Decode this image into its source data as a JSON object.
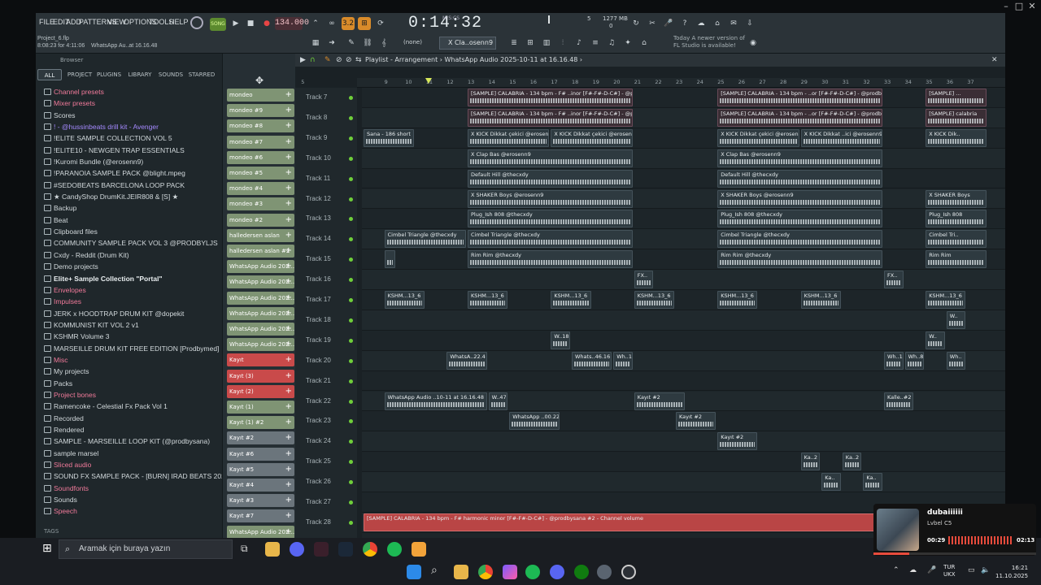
{
  "window": {
    "min": "–",
    "max": "□",
    "close": "✕"
  },
  "menu": [
    "FILE",
    "EDIT",
    "ADD",
    "PATTERNS",
    "VIEW",
    "OPTIONS",
    "TOOLS",
    "HELP"
  ],
  "toolbar": {
    "tempo": "134.000",
    "time": "0:14:32",
    "time_unit": "M:S:CS",
    "pattern_select": "X Cla..osenn9",
    "none_label": "(none)",
    "cpu": "5",
    "mem": "1277 MB",
    "mem_sub": "0"
  },
  "project": {
    "name": "Project_6.flp",
    "pos": "8:08:23 for 4:11:06",
    "last": "WhatsApp Au..at 16.16.48"
  },
  "hint": {
    "line1": "Today  A newer version of",
    "line2": "FL Studio is available!"
  },
  "browser": {
    "title": "Browser",
    "tabs": [
      "ALL",
      "PROJECT",
      "PLUGINS",
      "LIBRARY",
      "SOUNDS",
      "STARRED"
    ],
    "items": [
      {
        "label": "Channel presets",
        "style": "pink"
      },
      {
        "label": "Mixer presets",
        "style": "pink"
      },
      {
        "label": "Scores",
        "style": "normal"
      },
      {
        "label": "! - @hussinbeats drill kit - Avenger",
        "style": "purple"
      },
      {
        "label": "!ELITE SAMPLE COLLECTION VOL 5",
        "style": "normal"
      },
      {
        "label": "!ELITE10 - NEWGEN TRAP ESSENTIALS",
        "style": "normal"
      },
      {
        "label": "!Kuromi Bundle (@erosenn9)",
        "style": "normal"
      },
      {
        "label": "!PARANOIA SAMPLE PACK @blight.mpeg",
        "style": "normal"
      },
      {
        "label": "#SEDOBEATS BARCELONA LOOP PACK",
        "style": "normal"
      },
      {
        "label": "★ CandyShop DrumKit.JEIR808 & [S] ★",
        "style": "normal"
      },
      {
        "label": "Backup",
        "style": "normal"
      },
      {
        "label": "Beat",
        "style": "normal"
      },
      {
        "label": "Clipboard files",
        "style": "normal"
      },
      {
        "label": "COMMUNITY SAMPLE PACK VOL 3 @PRODBYLJS",
        "style": "normal"
      },
      {
        "label": "Cxdy - Reddit (Drum Kit)",
        "style": "normal"
      },
      {
        "label": "Demo projects",
        "style": "normal"
      },
      {
        "label": "Elite+ Sample Collection \"Portal\"",
        "style": "bold"
      },
      {
        "label": "Envelopes",
        "style": "pink"
      },
      {
        "label": "Impulses",
        "style": "pink"
      },
      {
        "label": "JERK x HOODTRAP DRUM KIT @dopekit",
        "style": "normal"
      },
      {
        "label": "KOMMUNIST KIT VOL 2 v1",
        "style": "normal"
      },
      {
        "label": "KSHMR Volume 3",
        "style": "normal"
      },
      {
        "label": "MARSEILLE DRUM KIT FREE EDITION [Prodbymed]",
        "style": "normal"
      },
      {
        "label": "Misc",
        "style": "pink"
      },
      {
        "label": "My projects",
        "style": "normal"
      },
      {
        "label": "Packs",
        "style": "normal"
      },
      {
        "label": "Project bones",
        "style": "pink"
      },
      {
        "label": "Ramencoke - Celestial Fx Pack Vol 1",
        "style": "normal"
      },
      {
        "label": "Recorded",
        "style": "normal"
      },
      {
        "label": "Rendered",
        "style": "normal"
      },
      {
        "label": "SAMPLE - MARSEILLE LOOP KIT (@prodbysana)",
        "style": "normal"
      },
      {
        "label": "sample marsel",
        "style": "normal"
      },
      {
        "label": "Sliced audio",
        "style": "pink"
      },
      {
        "label": "SOUND FX SAMPLE PACK - [BURN] IRAD BEATS 2024",
        "style": "normal"
      },
      {
        "label": "Soundfonts",
        "style": "pink"
      },
      {
        "label": "Sounds",
        "style": "normal"
      },
      {
        "label": "Speech",
        "style": "pink"
      }
    ],
    "tags": "TAGS"
  },
  "channels": [
    {
      "label": "mondeo",
      "style": "green"
    },
    {
      "label": "mondeo #9",
      "style": "green"
    },
    {
      "label": "mondeo #8",
      "style": "green"
    },
    {
      "label": "mondeo #7",
      "style": "green"
    },
    {
      "label": "mondeo #6",
      "style": "green"
    },
    {
      "label": "mondeo #5",
      "style": "green"
    },
    {
      "label": "mondeo #4",
      "style": "green"
    },
    {
      "label": "mondeo #3",
      "style": "green"
    },
    {
      "label": "mondeo #2",
      "style": "green"
    },
    {
      "label": "halledersen aslan",
      "style": "green"
    },
    {
      "label": "halledersen aslan #2",
      "style": "green"
    },
    {
      "label": "WhatsApp Audio 202...",
      "style": "green"
    },
    {
      "label": "WhatsApp Audio 202...",
      "style": "green"
    },
    {
      "label": "WhatsApp Audio 202...",
      "style": "green"
    },
    {
      "label": "WhatsApp Audio 202...",
      "style": "green"
    },
    {
      "label": "WhatsApp Audio 202...",
      "style": "green"
    },
    {
      "label": "WhatsApp Audio 202...",
      "style": "green"
    },
    {
      "label": "Kayıt",
      "style": "red"
    },
    {
      "label": "Kayıt (3)",
      "style": "red"
    },
    {
      "label": "Kayıt (2)",
      "style": "red"
    },
    {
      "label": "Kayıt (1)",
      "style": "green"
    },
    {
      "label": "Kayıt (1) #2",
      "style": "green"
    },
    {
      "label": "Kayıt #2",
      "style": "gray"
    },
    {
      "label": "Kayıt #6",
      "style": "gray"
    },
    {
      "label": "Kayıt #5",
      "style": "gray"
    },
    {
      "label": "Kayıt #4",
      "style": "gray"
    },
    {
      "label": "Kayıt #3",
      "style": "gray"
    },
    {
      "label": "Kayıt #7",
      "style": "gray"
    },
    {
      "label": "WhatsApp Audio 202...",
      "style": "green"
    }
  ],
  "playlist": {
    "title": "Playlist - Arrangement › WhatsApp Audio 2025-10-11 at 16.16.48 ›",
    "ruler": [
      "5",
      "9",
      "10",
      "11",
      "12",
      "13",
      "14",
      "15",
      "16",
      "17",
      "18",
      "19",
      "20",
      "21",
      "22",
      "23",
      "24",
      "25",
      "26",
      "27",
      "28",
      "29",
      "30",
      "31",
      "32",
      "33",
      "34",
      "35",
      "36",
      "37"
    ],
    "tracks": [
      "Track 7",
      "Track 8",
      "Track 9",
      "Track 10",
      "Track 11",
      "Track 12",
      "Track 13",
      "Track 14",
      "Track 15",
      "Track 16",
      "Track 17",
      "Track 18",
      "Track 19",
      "Track 20",
      "Track 21",
      "Track 22",
      "Track 23",
      "Track 24",
      "Track 25",
      "Track 26",
      "Track 27",
      "Track 28"
    ],
    "clips": [
      {
        "lane": 0,
        "label": "[SAMPLE] CALABRIA - 134 bpm - F# ..inor [F#-F#-D-C#] - @prodbysana",
        "start": 13,
        "len": 8,
        "style": "pink"
      },
      {
        "lane": 0,
        "label": "[SAMPLE] CALABRIA - 134 bpm - ..or [F#-F#-D-C#] - @prodbysana",
        "start": 25,
        "len": 8,
        "style": "pink"
      },
      {
        "lane": 0,
        "label": "[SAMPLE] ...",
        "start": 35,
        "len": 3,
        "style": "pink"
      },
      {
        "lane": 1,
        "label": "[SAMPLE] CALABRIA - 134 bpm - F# ..inor [F#-F#-D-C#] - @prodbysana",
        "start": 13,
        "len": 8,
        "style": "pink"
      },
      {
        "lane": 1,
        "label": "[SAMPLE] CALABRIA - 134 bpm - ..or [F#-F#-D-C#] - @prodbysana",
        "start": 25,
        "len": 8,
        "style": "pink"
      },
      {
        "lane": 1,
        "label": "[SAMPLE] calabria",
        "start": 35,
        "len": 3,
        "style": "pink"
      },
      {
        "lane": 2,
        "label": "Sana - 186 short",
        "start": 8,
        "len": 2.5,
        "style": "normal"
      },
      {
        "lane": 2,
        "label": "X KICK Dikkat çekici @erosenn9",
        "start": 13,
        "len": 4,
        "style": "normal"
      },
      {
        "lane": 2,
        "label": "X KICK Dikkat çekici @erosenn9",
        "start": 17,
        "len": 4,
        "style": "normal"
      },
      {
        "lane": 2,
        "label": "X KICK Dikkat çekici @erosenn9",
        "start": 25,
        "len": 4,
        "style": "normal"
      },
      {
        "lane": 2,
        "label": "X KICK Dikkat ..ici @erosenn9",
        "start": 29,
        "len": 4,
        "style": "normal"
      },
      {
        "lane": 2,
        "label": "X KICK Dik..",
        "start": 35,
        "len": 3,
        "style": "normal"
      },
      {
        "lane": 3,
        "label": "X Clap Bas @erosenn9",
        "start": 13,
        "len": 8,
        "style": "normal"
      },
      {
        "lane": 3,
        "label": "X Clap Bas @erosenn9",
        "start": 25,
        "len": 8,
        "style": "normal"
      },
      {
        "lane": 4,
        "label": "Default Hill @thecxdy",
        "start": 13,
        "len": 8,
        "style": "normal"
      },
      {
        "lane": 4,
        "label": "Default Hill @thecxdy",
        "start": 25,
        "len": 8,
        "style": "normal"
      },
      {
        "lane": 5,
        "label": "X SHAKER Boys @erosenn9",
        "start": 13,
        "len": 8,
        "style": "normal"
      },
      {
        "lane": 5,
        "label": "X SHAKER Boys @erosenn9",
        "start": 25,
        "len": 8,
        "style": "normal"
      },
      {
        "lane": 5,
        "label": "X SHAKER Boys",
        "start": 35,
        "len": 3,
        "style": "normal"
      },
      {
        "lane": 6,
        "label": "Plug_Ish 808 @thecxdy",
        "start": 13,
        "len": 8,
        "style": "normal"
      },
      {
        "lane": 6,
        "label": "Plug_Ish 808 @thecxdy",
        "start": 25,
        "len": 8,
        "style": "normal"
      },
      {
        "lane": 6,
        "label": "Plug_Ish 808",
        "start": 35,
        "len": 3,
        "style": "normal"
      },
      {
        "lane": 7,
        "label": "Cimbel Triangle @thecxdy",
        "start": 9,
        "len": 4,
        "style": "normal"
      },
      {
        "lane": 7,
        "label": "Cimbel Triangle @thecxdy",
        "start": 13,
        "len": 8,
        "style": "normal"
      },
      {
        "lane": 7,
        "label": "Cimbel Triangle @thecxdy",
        "start": 25,
        "len": 8,
        "style": "normal"
      },
      {
        "lane": 7,
        "label": "Cimbel Tri..",
        "start": 35,
        "len": 3,
        "style": "normal"
      },
      {
        "lane": 8,
        "label": "",
        "start": 9,
        "len": 0.6,
        "style": "normal"
      },
      {
        "lane": 8,
        "label": "Rim Rim @thecxdy",
        "start": 13,
        "len": 8,
        "style": "normal"
      },
      {
        "lane": 8,
        "label": "Rim Rim @thecxdy",
        "start": 25,
        "len": 8,
        "style": "normal"
      },
      {
        "lane": 8,
        "label": "Rim Rim",
        "start": 35,
        "len": 3,
        "style": "normal"
      },
      {
        "lane": 9,
        "label": "FX..",
        "start": 21,
        "len": 1,
        "style": "normal"
      },
      {
        "lane": 9,
        "label": "FX..",
        "start": 33,
        "len": 1,
        "style": "normal"
      },
      {
        "lane": 10,
        "label": "KSHM...13_6",
        "start": 9,
        "len": 2,
        "style": "normal"
      },
      {
        "lane": 10,
        "label": "KSHM...13_6",
        "start": 13,
        "len": 2,
        "style": "normal"
      },
      {
        "lane": 10,
        "label": "KSHM...13_6",
        "start": 17,
        "len": 2,
        "style": "normal"
      },
      {
        "lane": 10,
        "label": "KSHM...13_6",
        "start": 21,
        "len": 2,
        "style": "normal"
      },
      {
        "lane": 10,
        "label": "KSHM...13_6",
        "start": 25,
        "len": 2,
        "style": "normal"
      },
      {
        "lane": 10,
        "label": "KSHM...13_6",
        "start": 29,
        "len": 2,
        "style": "normal"
      },
      {
        "lane": 10,
        "label": "KSHM...13_6",
        "start": 35,
        "len": 2,
        "style": "normal"
      },
      {
        "lane": 11,
        "label": "W..",
        "start": 36,
        "len": 1,
        "style": "normal"
      },
      {
        "lane": 12,
        "label": "W..18",
        "start": 17,
        "len": 1,
        "style": "normal"
      },
      {
        "lane": 12,
        "label": "W..",
        "start": 35,
        "len": 1,
        "style": "normal"
      },
      {
        "lane": 13,
        "label": "WhatsA..22.4",
        "start": 12,
        "len": 2,
        "style": "normal"
      },
      {
        "lane": 13,
        "label": "Whats..46.16",
        "start": 18,
        "len": 2,
        "style": "normal"
      },
      {
        "lane": 13,
        "label": "Wh..18",
        "start": 20,
        "len": 1,
        "style": "normal"
      },
      {
        "lane": 13,
        "label": "Wh..1",
        "start": 33,
        "len": 1,
        "style": "normal"
      },
      {
        "lane": 13,
        "label": "Wh..8",
        "start": 34,
        "len": 1,
        "style": "normal"
      },
      {
        "lane": 13,
        "label": "Wh..",
        "start": 36,
        "len": 1,
        "style": "normal"
      },
      {
        "lane": 15,
        "label": "WhatsApp Audio ..10-11 at 16.16.48",
        "start": 9,
        "len": 5,
        "style": "normal"
      },
      {
        "lane": 15,
        "label": "W..47",
        "start": 14,
        "len": 1,
        "style": "normal"
      },
      {
        "lane": 15,
        "label": "Kayıt #2",
        "start": 21,
        "len": 2.5,
        "style": "normal"
      },
      {
        "lane": 15,
        "label": "Kalle..#2",
        "start": 33,
        "len": 1.5,
        "style": "normal"
      },
      {
        "lane": 16,
        "label": "WhatsApp ..00.22.4",
        "start": 15,
        "len": 2.5,
        "style": "normal"
      },
      {
        "lane": 16,
        "label": "Kayıt #2",
        "start": 23,
        "len": 2,
        "style": "normal"
      },
      {
        "lane": 17,
        "label": "Kayıt #2",
        "start": 25,
        "len": 2,
        "style": "normal"
      },
      {
        "lane": 18,
        "label": "Ka..2",
        "start": 29,
        "len": 1,
        "style": "normal"
      },
      {
        "lane": 18,
        "label": "Ka..2",
        "start": 31,
        "len": 1,
        "style": "normal"
      },
      {
        "lane": 19,
        "label": "Ka..",
        "start": 30,
        "len": 1,
        "style": "normal"
      },
      {
        "lane": 19,
        "label": "Ka..",
        "start": 32,
        "len": 1,
        "style": "normal"
      },
      {
        "lane": 21,
        "label": "[SAMPLE] CALABRIA - 134 bpm - F# harmonic minor [F#-F#-D-C#] - @prodbysana #2 - Channel volume",
        "start": 8,
        "len": 31,
        "style": "red"
      }
    ]
  },
  "taskbar": {
    "search": "Aramak için buraya yazın",
    "lang": "TUR",
    "lang_sub": "UKX",
    "time": "16:21",
    "date": "11.10.2025"
  },
  "spotify": {
    "title": "dubaiiiiii",
    "artist": "Lvbel C5",
    "elapsed": "00:29",
    "total": "02:13",
    "progress": 0.22
  }
}
